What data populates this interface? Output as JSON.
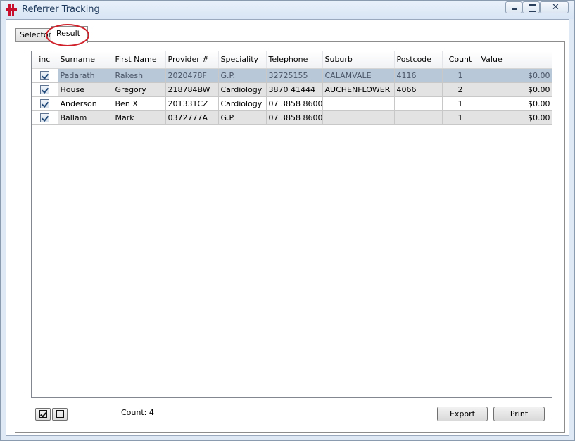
{
  "window": {
    "title": "Referrer Tracking",
    "close_glyph": "✕"
  },
  "tabs": [
    {
      "label": "Selector"
    },
    {
      "label": "Result"
    }
  ],
  "table": {
    "columns": [
      "inc",
      "Surname",
      "First Name",
      "Provider #",
      "Speciality",
      "Telephone",
      "Suburb",
      "Postcode",
      "Count",
      "Value"
    ],
    "rows": [
      {
        "inc": true,
        "surname": "Padarath",
        "first_name": "Rakesh",
        "provider": "2020478F",
        "speciality": "G.P.",
        "telephone": "32725155",
        "suburb": "CALAMVALE",
        "postcode": "4116",
        "count": "1",
        "value": "$0.00"
      },
      {
        "inc": true,
        "surname": "House",
        "first_name": "Gregory",
        "provider": "218784BW",
        "speciality": "Cardiology",
        "telephone": "3870 41444",
        "suburb": "AUCHENFLOWER",
        "postcode": "4066",
        "count": "2",
        "value": "$0.00"
      },
      {
        "inc": true,
        "surname": "Anderson",
        "first_name": "Ben X",
        "provider": "201331CZ",
        "speciality": "Cardiology",
        "telephone": "07 3858 8600",
        "suburb": "",
        "postcode": "",
        "count": "1",
        "value": "$0.00"
      },
      {
        "inc": true,
        "surname": "Ballam",
        "first_name": "Mark",
        "provider": "0372777A",
        "speciality": "G.P.",
        "telephone": "07 3858 8600",
        "suburb": "",
        "postcode": "",
        "count": "1",
        "value": "$0.00"
      }
    ]
  },
  "footer": {
    "count_label": "Count: 4",
    "export_label": "Export",
    "print_label": "Print"
  },
  "colors": {
    "accent": "#c8102e",
    "highlight_ring": "#d0202a",
    "selected_row": "#b9c8d8"
  },
  "icons": {
    "app": "medical-cross-icon",
    "check_all": "check-all-icon",
    "uncheck_all": "uncheck-all-icon"
  }
}
